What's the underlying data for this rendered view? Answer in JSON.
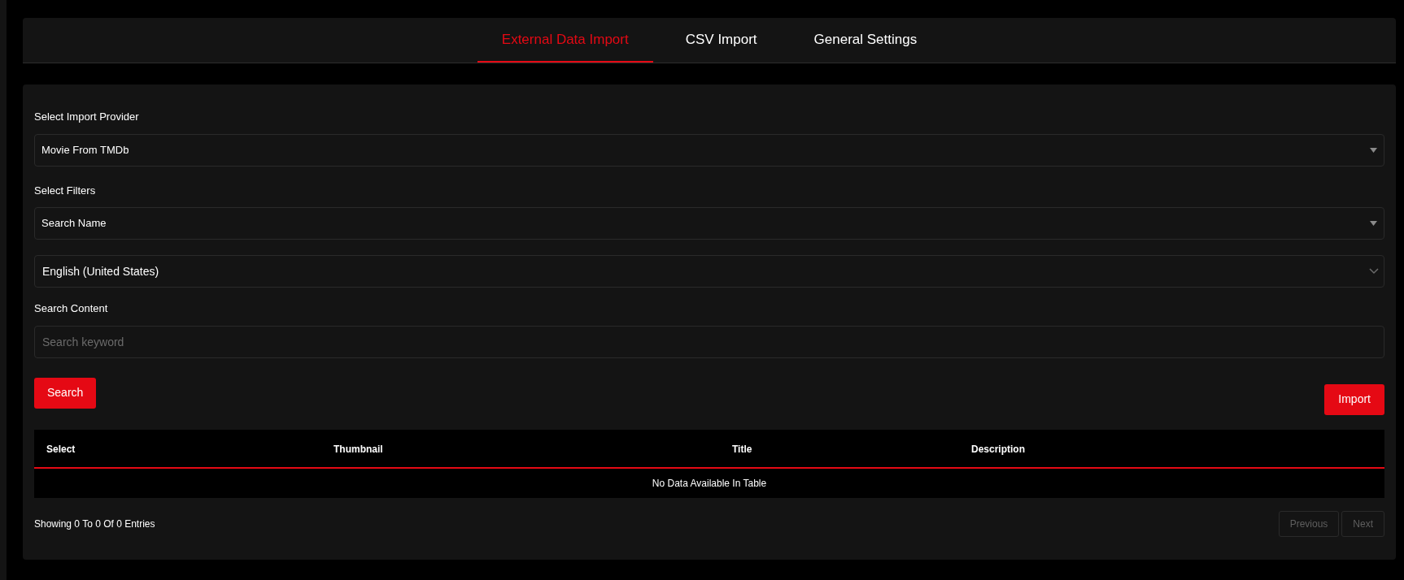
{
  "tabs": [
    {
      "label": "External Data Import",
      "selected": true
    },
    {
      "label": "CSV Import",
      "selected": false
    },
    {
      "label": "General Settings",
      "selected": false
    }
  ],
  "form": {
    "provider": {
      "label": "Select Import Provider",
      "value": "Movie From TMDb"
    },
    "filters": {
      "label": "Select Filters",
      "value": "Search Name"
    },
    "language": {
      "value": "English (United States)"
    },
    "search_content": {
      "label": "Search Content",
      "placeholder": "Search keyword"
    },
    "search_button": "Search",
    "import_button": "Import"
  },
  "table": {
    "columns": [
      "Select",
      "Thumbnail",
      "Title",
      "Description"
    ],
    "empty_message": "No Data Available In Table"
  },
  "footer": {
    "info": "Showing 0 To 0 Of 0 Entries",
    "pagination": [
      {
        "label": "Previous",
        "disabled": true
      },
      {
        "label": "Next",
        "disabled": true
      }
    ]
  }
}
